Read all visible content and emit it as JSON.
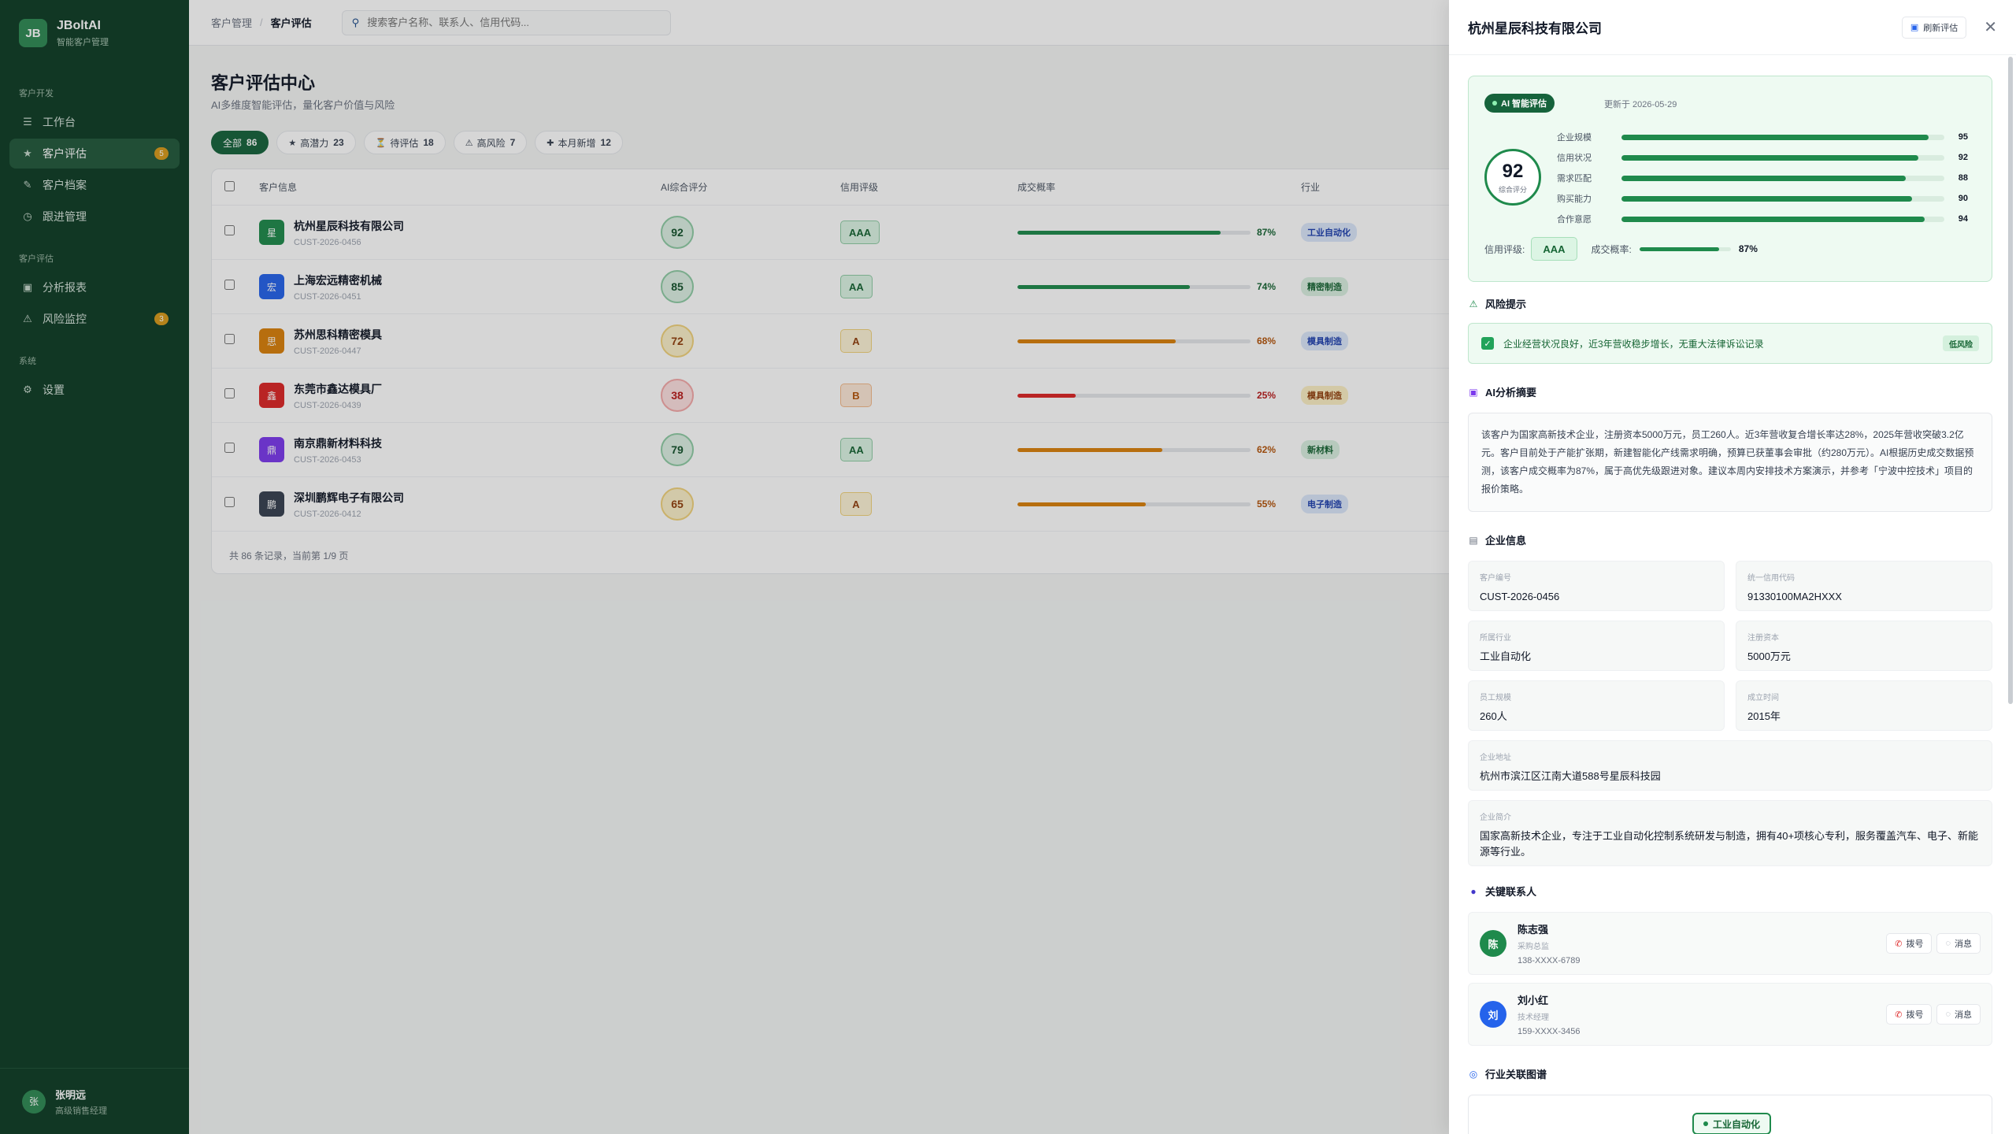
{
  "app": {
    "logo": "JB",
    "name": "JBoltAI",
    "subtitle": "智能客户管理"
  },
  "sidebar": {
    "groups": [
      {
        "title": "客户开发",
        "items": [
          {
            "label": "工作台",
            "icon": "menu-icon"
          },
          {
            "label": "客户评估",
            "icon": "star-icon",
            "badge": "5",
            "active": true
          },
          {
            "label": "客户档案",
            "icon": "pen-icon"
          },
          {
            "label": "跟进管理",
            "icon": "clock-icon"
          }
        ]
      },
      {
        "title": "客户评估",
        "items": [
          {
            "label": "分析报表",
            "icon": "chart-icon"
          },
          {
            "label": "风险监控",
            "icon": "warning-icon",
            "badge": "3"
          }
        ]
      },
      {
        "title": "系统",
        "items": [
          {
            "label": "设置",
            "icon": "gear-icon"
          }
        ]
      }
    ],
    "user": {
      "avatar": "张",
      "name": "张明远",
      "role": "高级销售经理"
    }
  },
  "topbar": {
    "breadcrumb": [
      "客户管理",
      "客户评估"
    ],
    "search_placeholder": "搜索客户名称、联系人、信用代码..."
  },
  "page": {
    "title": "客户评估中心",
    "subtitle": "AI多维度智能评估，量化客户价值与风险",
    "filters": [
      {
        "icon": "",
        "label": "全部",
        "count": "86",
        "active": true
      },
      {
        "icon": "★",
        "label": "高潜力",
        "count": "23"
      },
      {
        "icon": "⏳",
        "label": "待评估",
        "count": "18"
      },
      {
        "icon": "⚠",
        "label": "高风险",
        "count": "7"
      },
      {
        "icon": "✚",
        "label": "本月新增",
        "count": "12"
      }
    ]
  },
  "table": {
    "headers": [
      "客户信息",
      "AI综合评分",
      "信用评级",
      "成交概率",
      "行业"
    ],
    "rows": [
      {
        "avatar": "星",
        "avatar_color": "#1f8a4c",
        "name": "杭州星辰科技有限公司",
        "id": "CUST-2026-0456",
        "score": "92",
        "level": "high",
        "credit": "AAA",
        "prob": 87,
        "prob_label": "87%",
        "industry": "工业自动化",
        "ind_style": "blue"
      },
      {
        "avatar": "宏",
        "avatar_color": "#2563eb",
        "name": "上海宏远精密机械",
        "id": "CUST-2026-0451",
        "score": "85",
        "level": "high",
        "credit": "AA",
        "prob": 74,
        "prob_label": "74%",
        "industry": "精密制造",
        "ind_style": "green"
      },
      {
        "avatar": "思",
        "avatar_color": "#d9800b",
        "name": "苏州思科精密模具",
        "id": "CUST-2026-0447",
        "score": "72",
        "level": "mid",
        "credit": "A",
        "prob": 68,
        "prob_label": "68%",
        "industry": "模具制造",
        "ind_style": "blue"
      },
      {
        "avatar": "鑫",
        "avatar_color": "#dc2626",
        "name": "东莞市鑫达模具厂",
        "id": "CUST-2026-0439",
        "score": "38",
        "level": "low",
        "credit": "B",
        "prob": 25,
        "prob_label": "25%",
        "industry": "模具制造",
        "ind_style": "yellow"
      },
      {
        "avatar": "鼎",
        "avatar_color": "#7c3aed",
        "name": "南京鼎新材料科技",
        "id": "CUST-2026-0453",
        "score": "79",
        "level": "high",
        "credit": "AA",
        "prob": 62,
        "prob_label": "62%",
        "industry": "新材料",
        "ind_style": "green"
      },
      {
        "avatar": "鹏",
        "avatar_color": "#374151",
        "name": "深圳鹏辉电子有限公司",
        "id": "CUST-2026-0412",
        "score": "65",
        "level": "mid",
        "credit": "A",
        "prob": 55,
        "prob_label": "55%",
        "industry": "电子制造",
        "ind_style": "blue"
      }
    ],
    "footer": "共 86 条记录，当前第 1/9 页"
  },
  "drawer": {
    "title": "杭州星辰科技有限公司",
    "refresh_label": "刷新评估",
    "ai": {
      "badge": "AI 智能评估",
      "updated": "更新于 2026-05-29",
      "score": "92",
      "score_label": "综合评分",
      "dims": [
        {
          "label": "企业规模",
          "value": 95
        },
        {
          "label": "信用状况",
          "value": 92
        },
        {
          "label": "需求匹配",
          "value": 88
        },
        {
          "label": "购买能力",
          "value": 90
        },
        {
          "label": "合作意愿",
          "value": 94
        }
      ],
      "credit_label": "信用评级:",
      "credit": "AAA",
      "prob_label": "成交概率:",
      "prob": 87,
      "prob_text": "87%"
    },
    "risk": {
      "title": "风险提示",
      "text": "企业经营状况良好，近3年营收稳步增长，无重大法律诉讼记录",
      "tag": "低风险"
    },
    "summary": {
      "title": "AI分析摘要",
      "text": "该客户为国家高新技术企业，注册资本5000万元，员工260人。近3年营收复合增长率达28%，2025年营收突破3.2亿元。客户目前处于产能扩张期，新建智能化产线需求明确，预算已获董事会审批（约280万元）。AI根据历史成交数据预测，该客户成交概率为87%，属于高优先级跟进对象。建议本周内安排技术方案演示，并参考「宁波中控技术」项目的报价策略。"
    },
    "info": {
      "title": "企业信息",
      "cells": [
        {
          "label": "客户编号",
          "value": "CUST-2026-0456"
        },
        {
          "label": "统一信用代码",
          "value": "91330100MA2HXXX"
        },
        {
          "label": "所属行业",
          "value": "工业自动化"
        },
        {
          "label": "注册资本",
          "value": "5000万元"
        },
        {
          "label": "员工规模",
          "value": "260人"
        },
        {
          "label": "成立时间",
          "value": "2015年"
        },
        {
          "label": "企业地址",
          "value": "杭州市滨江区江南大道588号星辰科技园"
        },
        {
          "label": "企业简介",
          "value": "国家高新技术企业，专注于工业自动化控制系统研发与制造，拥有40+项核心专利，服务覆盖汽车、电子、新能源等行业。"
        }
      ]
    },
    "contacts": {
      "title": "关键联系人",
      "call_label": "拨号",
      "msg_label": "消息",
      "items": [
        {
          "avatar": "陈",
          "color": "#1f8a4c",
          "name": "陈志强",
          "role": "采购总监",
          "phone": "138-XXXX-6789"
        },
        {
          "avatar": "刘",
          "color": "#2563eb",
          "name": "刘小红",
          "role": "技术经理",
          "phone": "159-XXXX-3456"
        }
      ]
    },
    "graph": {
      "title": "行业关联图谱",
      "node": "工业自动化"
    }
  }
}
